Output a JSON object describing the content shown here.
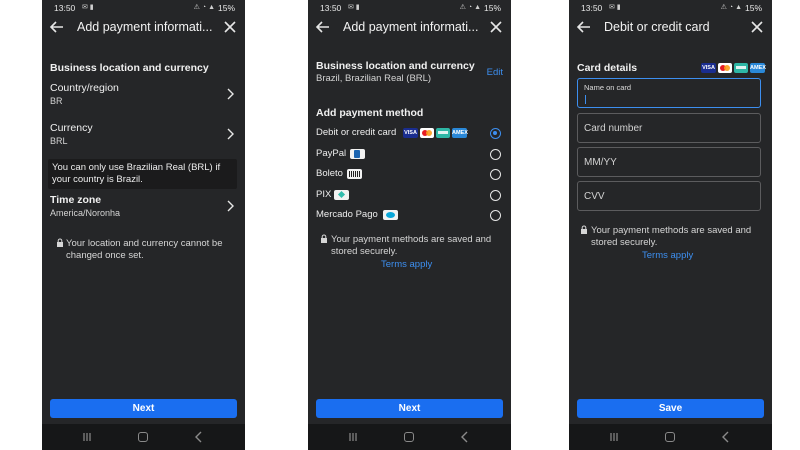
{
  "status": {
    "time": "13:50",
    "battery": "15%"
  },
  "screen1": {
    "title": "Add payment informati...",
    "section": "Business location and currency",
    "country_label": "Country/region",
    "country_value": "BR",
    "currency_label": "Currency",
    "currency_value": "BRL",
    "info": "You can only use Brazilian Real (BRL) if your country is Brazil.",
    "timezone_label": "Time zone",
    "timezone_value": "America/Noronha",
    "lock_note": "Your location and currency cannot be changed once set.",
    "button": "Next"
  },
  "screen2": {
    "title": "Add payment informati...",
    "section": "Business location and currency",
    "location_value": "Brazil, Brazilian Real (BRL)",
    "edit": "Edit",
    "methods_title": "Add payment method",
    "methods": [
      {
        "label": "Debit or credit card",
        "selected": true
      },
      {
        "label": "PayPal",
        "selected": false
      },
      {
        "label": "Boleto",
        "selected": false
      },
      {
        "label": "PIX",
        "selected": false
      },
      {
        "label": "Mercado Pago",
        "selected": false
      }
    ],
    "badges": {
      "visa": "VISA",
      "amex": "AMEX"
    },
    "note": "Your payment methods are saved and stored securely.",
    "terms": "Terms apply",
    "button": "Next"
  },
  "screen3": {
    "title": "Debit or credit card",
    "section": "Card details",
    "fields": {
      "name_label": "Name on card",
      "number_placeholder": "Card number",
      "expiry_placeholder": "MM/YY",
      "cvv_placeholder": "CVV"
    },
    "note": "Your payment methods are saved and stored securely.",
    "terms": "Terms apply",
    "button": "Save"
  },
  "colors": {
    "background": "#252628",
    "accent": "#1a6ef0",
    "link": "#3d8ff0"
  }
}
